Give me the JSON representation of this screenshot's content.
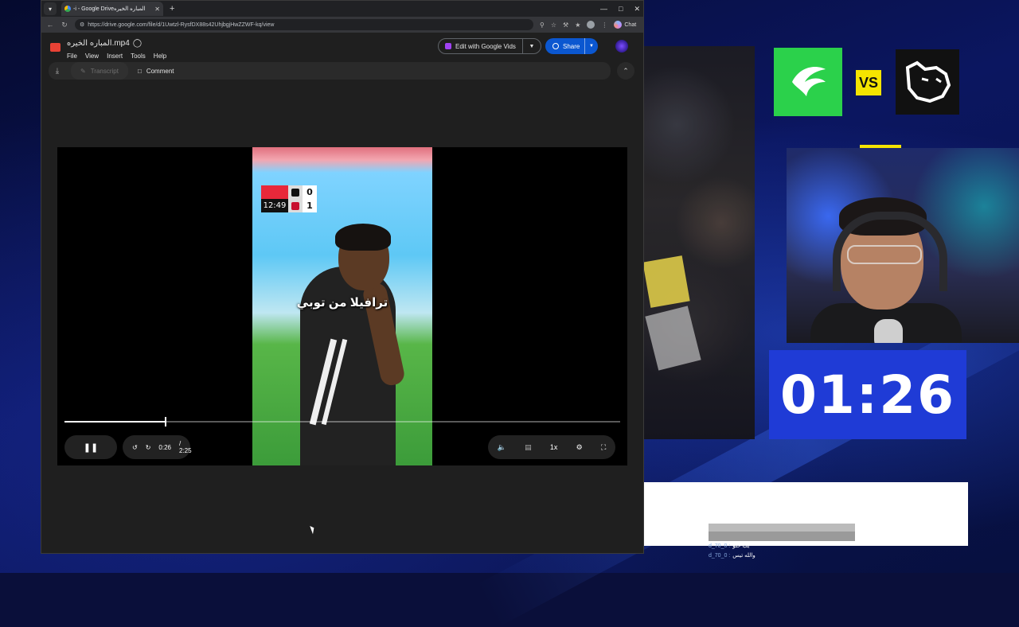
{
  "browser": {
    "tab_title": "-i - Google Driveالمباره الخيره",
    "url": "https://drive.google.com/file/d/1Uwtzl-RysfDX88s42UhjbgjHwZZWF-kq/view",
    "chat_label": "Chat"
  },
  "drive": {
    "file_name": "المباره الخيره.mp4",
    "menu": [
      "File",
      "View",
      "Insert",
      "Tools",
      "Help"
    ],
    "edit_vids_label": "Edit with Google Vids",
    "share_label": "Share",
    "transcript_label": "Transcript",
    "comment_label": "Comment"
  },
  "video": {
    "current_time": "0:26",
    "duration": "/ 2:25",
    "progress": 0.18,
    "speed_label": "1x",
    "caption": "ترافيلا من توبي",
    "scorebug": {
      "score_home": "0",
      "score_away": "1",
      "clock": "12:49"
    }
  },
  "stream": {
    "vs_label": "VS",
    "timer": "01:26",
    "chat": [
      {
        "user": "d_70_0 :",
        "msg": "يب حلو"
      },
      {
        "user": "d_70_0 :",
        "msg": "والله تيس"
      }
    ]
  },
  "colors": {
    "share_button": "#0b57d0",
    "timer_bg": "#1f3bd6",
    "team_left": "#2bd14b",
    "vs_badge": "#f5e400"
  }
}
